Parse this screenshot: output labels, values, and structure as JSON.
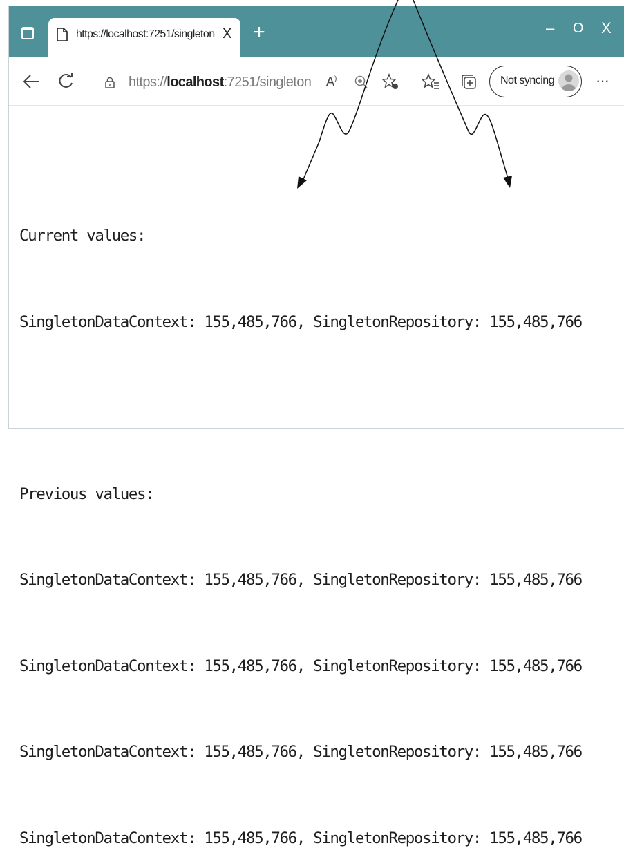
{
  "browser": {
    "tab": {
      "title": "https://localhost:7251/singleton",
      "close_glyph": "X"
    },
    "new_tab_glyph": "+",
    "window_controls": {
      "minimize": "–",
      "maximize": "O",
      "close": "X"
    },
    "address_bar": {
      "url_prefix": "https://",
      "url_host": "localhost",
      "url_rest": ":7251/singleton"
    },
    "read_aloud_label": "A",
    "sync_button_label": "Not syncing",
    "menu_label": "···",
    "theme_color": "#4e9199"
  },
  "page": {
    "lines": [
      "",
      "Current values:",
      "SingletonDataContext: 155,485,766, SingletonRepository: 155,485,766",
      "",
      "Previous values:",
      "SingletonDataContext: 155,485,766, SingletonRepository: 155,485,766",
      "SingletonDataContext: 155,485,766, SingletonRepository: 155,485,766",
      "SingletonDataContext: 155,485,766, SingletonRepository: 155,485,766",
      "SingletonDataContext: 155,485,766, SingletonRepository: 155,485,766"
    ]
  }
}
